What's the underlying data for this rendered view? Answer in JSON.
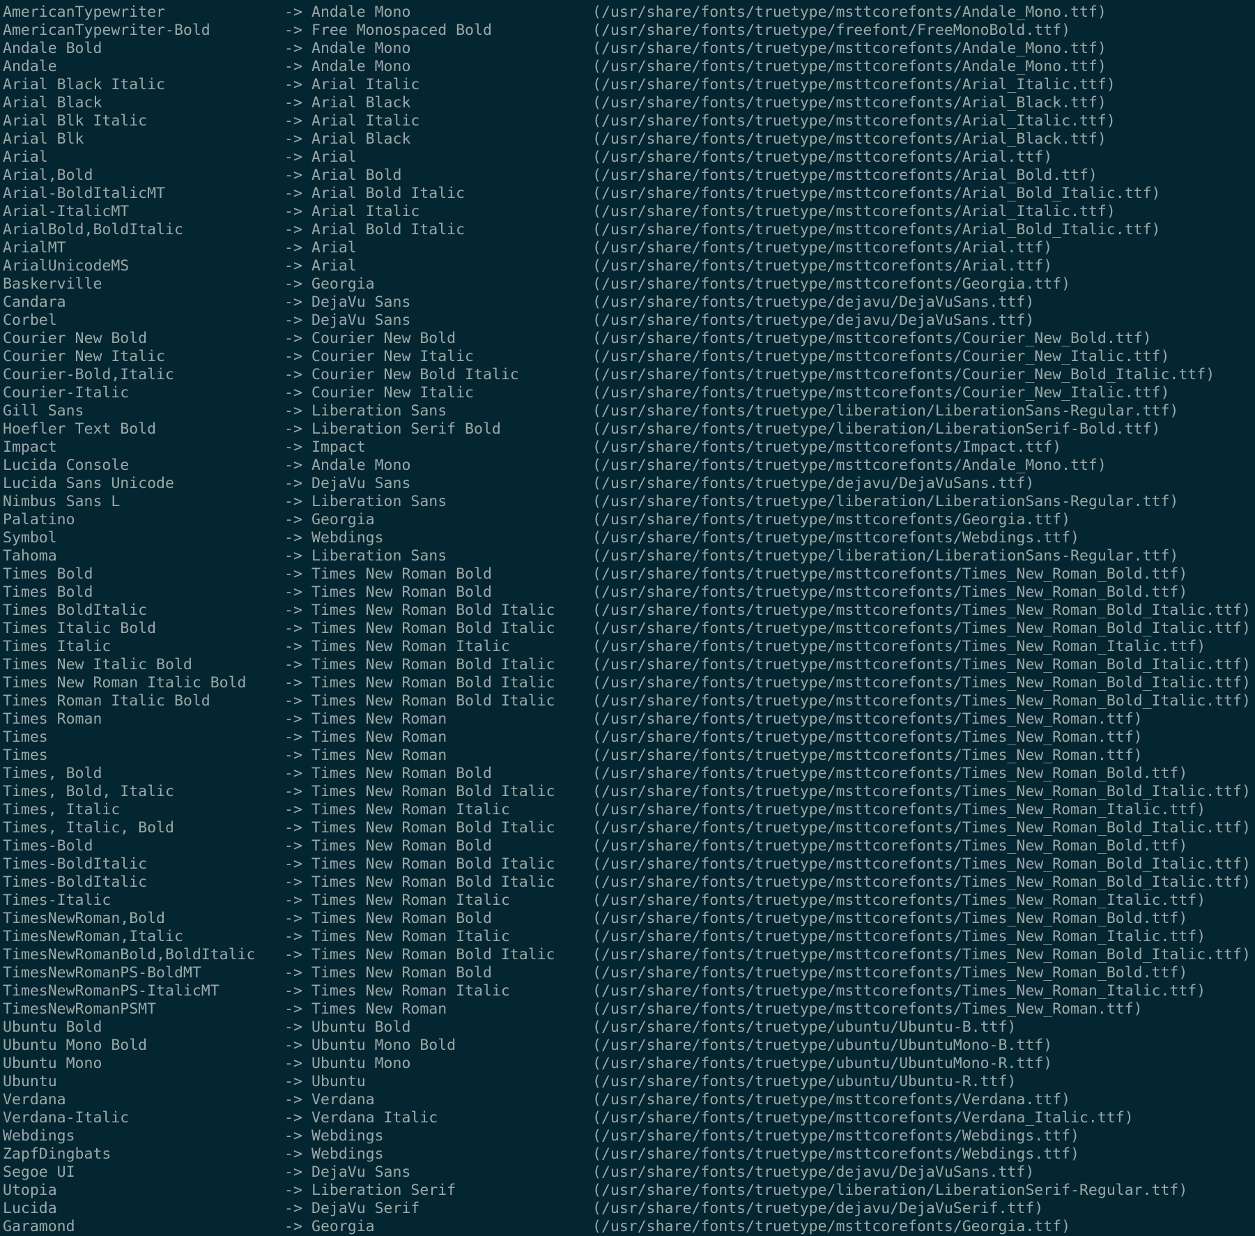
{
  "terminal": {
    "arrow": "->",
    "rows": [
      [
        "AmericanTypewriter",
        "Andale Mono",
        "(/usr/share/fonts/truetype/msttcorefonts/Andale_Mono.ttf)"
      ],
      [
        "AmericanTypewriter-Bold",
        "Free Monospaced Bold",
        "(/usr/share/fonts/truetype/freefont/FreeMonoBold.ttf)"
      ],
      [
        "Andale Bold",
        "Andale Mono",
        "(/usr/share/fonts/truetype/msttcorefonts/Andale_Mono.ttf)"
      ],
      [
        "Andale",
        "Andale Mono",
        "(/usr/share/fonts/truetype/msttcorefonts/Andale_Mono.ttf)"
      ],
      [
        "Arial Black Italic",
        "Arial Italic",
        "(/usr/share/fonts/truetype/msttcorefonts/Arial_Italic.ttf)"
      ],
      [
        "Arial Black",
        "Arial Black",
        "(/usr/share/fonts/truetype/msttcorefonts/Arial_Black.ttf)"
      ],
      [
        "Arial Blk Italic",
        "Arial Italic",
        "(/usr/share/fonts/truetype/msttcorefonts/Arial_Italic.ttf)"
      ],
      [
        "Arial Blk",
        "Arial Black",
        "(/usr/share/fonts/truetype/msttcorefonts/Arial_Black.ttf)"
      ],
      [
        "Arial",
        "Arial",
        "(/usr/share/fonts/truetype/msttcorefonts/Arial.ttf)"
      ],
      [
        "Arial,Bold",
        "Arial Bold",
        "(/usr/share/fonts/truetype/msttcorefonts/Arial_Bold.ttf)"
      ],
      [
        "Arial-BoldItalicMT",
        "Arial Bold Italic",
        "(/usr/share/fonts/truetype/msttcorefonts/Arial_Bold_Italic.ttf)"
      ],
      [
        "Arial-ItalicMT",
        "Arial Italic",
        "(/usr/share/fonts/truetype/msttcorefonts/Arial_Italic.ttf)"
      ],
      [
        "ArialBold,BoldItalic",
        "Arial Bold Italic",
        "(/usr/share/fonts/truetype/msttcorefonts/Arial_Bold_Italic.ttf)"
      ],
      [
        "ArialMT",
        "Arial",
        "(/usr/share/fonts/truetype/msttcorefonts/Arial.ttf)"
      ],
      [
        "ArialUnicodeMS",
        "Arial",
        "(/usr/share/fonts/truetype/msttcorefonts/Arial.ttf)"
      ],
      [
        "Baskerville",
        "Georgia",
        "(/usr/share/fonts/truetype/msttcorefonts/Georgia.ttf)"
      ],
      [
        "Candara",
        "DejaVu Sans",
        "(/usr/share/fonts/truetype/dejavu/DejaVuSans.ttf)"
      ],
      [
        "Corbel",
        "DejaVu Sans",
        "(/usr/share/fonts/truetype/dejavu/DejaVuSans.ttf)"
      ],
      [
        "Courier New Bold",
        "Courier New Bold",
        "(/usr/share/fonts/truetype/msttcorefonts/Courier_New_Bold.ttf)"
      ],
      [
        "Courier New Italic",
        "Courier New Italic",
        "(/usr/share/fonts/truetype/msttcorefonts/Courier_New_Italic.ttf)"
      ],
      [
        "Courier-Bold,Italic",
        "Courier New Bold Italic",
        "(/usr/share/fonts/truetype/msttcorefonts/Courier_New_Bold_Italic.ttf)"
      ],
      [
        "Courier-Italic",
        "Courier New Italic",
        "(/usr/share/fonts/truetype/msttcorefonts/Courier_New_Italic.ttf)"
      ],
      [
        "Gill Sans",
        "Liberation Sans",
        "(/usr/share/fonts/truetype/liberation/LiberationSans-Regular.ttf)"
      ],
      [
        "Hoefler Text Bold",
        "Liberation Serif Bold",
        "(/usr/share/fonts/truetype/liberation/LiberationSerif-Bold.ttf)"
      ],
      [
        "Impact",
        "Impact",
        "(/usr/share/fonts/truetype/msttcorefonts/Impact.ttf)"
      ],
      [
        "Lucida Console",
        "Andale Mono",
        "(/usr/share/fonts/truetype/msttcorefonts/Andale_Mono.ttf)"
      ],
      [
        "Lucida Sans Unicode",
        "DejaVu Sans",
        "(/usr/share/fonts/truetype/dejavu/DejaVuSans.ttf)"
      ],
      [
        "Nimbus Sans L",
        "Liberation Sans",
        "(/usr/share/fonts/truetype/liberation/LiberationSans-Regular.ttf)"
      ],
      [
        "Palatino",
        "Georgia",
        "(/usr/share/fonts/truetype/msttcorefonts/Georgia.ttf)"
      ],
      [
        "Symbol",
        "Webdings",
        "(/usr/share/fonts/truetype/msttcorefonts/Webdings.ttf)"
      ],
      [
        "Tahoma",
        "Liberation Sans",
        "(/usr/share/fonts/truetype/liberation/LiberationSans-Regular.ttf)"
      ],
      [
        "Times Bold",
        "Times New Roman Bold",
        "(/usr/share/fonts/truetype/msttcorefonts/Times_New_Roman_Bold.ttf)"
      ],
      [
        "Times Bold",
        "Times New Roman Bold",
        "(/usr/share/fonts/truetype/msttcorefonts/Times_New_Roman_Bold.ttf)"
      ],
      [
        "Times BoldItalic",
        "Times New Roman Bold Italic",
        "(/usr/share/fonts/truetype/msttcorefonts/Times_New_Roman_Bold_Italic.ttf)"
      ],
      [
        "Times Italic Bold",
        "Times New Roman Bold Italic",
        "(/usr/share/fonts/truetype/msttcorefonts/Times_New_Roman_Bold_Italic.ttf)"
      ],
      [
        "Times Italic",
        "Times New Roman Italic",
        "(/usr/share/fonts/truetype/msttcorefonts/Times_New_Roman_Italic.ttf)"
      ],
      [
        "Times New Italic Bold",
        "Times New Roman Bold Italic",
        "(/usr/share/fonts/truetype/msttcorefonts/Times_New_Roman_Bold_Italic.ttf)"
      ],
      [
        "Times New Roman Italic Bold",
        "Times New Roman Bold Italic",
        "(/usr/share/fonts/truetype/msttcorefonts/Times_New_Roman_Bold_Italic.ttf)"
      ],
      [
        "Times Roman Italic Bold",
        "Times New Roman Bold Italic",
        "(/usr/share/fonts/truetype/msttcorefonts/Times_New_Roman_Bold_Italic.ttf)"
      ],
      [
        "Times Roman",
        "Times New Roman",
        "(/usr/share/fonts/truetype/msttcorefonts/Times_New_Roman.ttf)"
      ],
      [
        "Times",
        "Times New Roman",
        "(/usr/share/fonts/truetype/msttcorefonts/Times_New_Roman.ttf)"
      ],
      [
        "Times",
        "Times New Roman",
        "(/usr/share/fonts/truetype/msttcorefonts/Times_New_Roman.ttf)"
      ],
      [
        "Times, Bold",
        "Times New Roman Bold",
        "(/usr/share/fonts/truetype/msttcorefonts/Times_New_Roman_Bold.ttf)"
      ],
      [
        "Times, Bold, Italic",
        "Times New Roman Bold Italic",
        "(/usr/share/fonts/truetype/msttcorefonts/Times_New_Roman_Bold_Italic.ttf)"
      ],
      [
        "Times, Italic",
        "Times New Roman Italic",
        "(/usr/share/fonts/truetype/msttcorefonts/Times_New_Roman_Italic.ttf)"
      ],
      [
        "Times, Italic, Bold",
        "Times New Roman Bold Italic",
        "(/usr/share/fonts/truetype/msttcorefonts/Times_New_Roman_Bold_Italic.ttf)"
      ],
      [
        "Times-Bold",
        "Times New Roman Bold",
        "(/usr/share/fonts/truetype/msttcorefonts/Times_New_Roman_Bold.ttf)"
      ],
      [
        "Times-BoldItalic",
        "Times New Roman Bold Italic",
        "(/usr/share/fonts/truetype/msttcorefonts/Times_New_Roman_Bold_Italic.ttf)"
      ],
      [
        "Times-BoldItalic",
        "Times New Roman Bold Italic",
        "(/usr/share/fonts/truetype/msttcorefonts/Times_New_Roman_Bold_Italic.ttf)"
      ],
      [
        "Times-Italic",
        "Times New Roman Italic",
        "(/usr/share/fonts/truetype/msttcorefonts/Times_New_Roman_Italic.ttf)"
      ],
      [
        "TimesNewRoman,Bold",
        "Times New Roman Bold",
        "(/usr/share/fonts/truetype/msttcorefonts/Times_New_Roman_Bold.ttf)"
      ],
      [
        "TimesNewRoman,Italic",
        "Times New Roman Italic",
        "(/usr/share/fonts/truetype/msttcorefonts/Times_New_Roman_Italic.ttf)"
      ],
      [
        "TimesNewRomanBold,BoldItalic",
        "Times New Roman Bold Italic",
        "(/usr/share/fonts/truetype/msttcorefonts/Times_New_Roman_Bold_Italic.ttf)"
      ],
      [
        "TimesNewRomanPS-BoldMT",
        "Times New Roman Bold",
        "(/usr/share/fonts/truetype/msttcorefonts/Times_New_Roman_Bold.ttf)"
      ],
      [
        "TimesNewRomanPS-ItalicMT",
        "Times New Roman Italic",
        "(/usr/share/fonts/truetype/msttcorefonts/Times_New_Roman_Italic.ttf)"
      ],
      [
        "TimesNewRomanPSMT",
        "Times New Roman",
        "(/usr/share/fonts/truetype/msttcorefonts/Times_New_Roman.ttf)"
      ],
      [
        "Ubuntu Bold",
        "Ubuntu Bold",
        "(/usr/share/fonts/truetype/ubuntu/Ubuntu-B.ttf)"
      ],
      [
        "Ubuntu Mono Bold",
        "Ubuntu Mono Bold",
        "(/usr/share/fonts/truetype/ubuntu/UbuntuMono-B.ttf)"
      ],
      [
        "Ubuntu Mono",
        "Ubuntu Mono",
        "(/usr/share/fonts/truetype/ubuntu/UbuntuMono-R.ttf)"
      ],
      [
        "Ubuntu",
        "Ubuntu",
        "(/usr/share/fonts/truetype/ubuntu/Ubuntu-R.ttf)"
      ],
      [
        "Verdana",
        "Verdana",
        "(/usr/share/fonts/truetype/msttcorefonts/Verdana.ttf)"
      ],
      [
        "Verdana-Italic",
        "Verdana Italic",
        "(/usr/share/fonts/truetype/msttcorefonts/Verdana_Italic.ttf)"
      ],
      [
        "Webdings",
        "Webdings",
        "(/usr/share/fonts/truetype/msttcorefonts/Webdings.ttf)"
      ],
      [
        "ZapfDingbats",
        "Webdings",
        "(/usr/share/fonts/truetype/msttcorefonts/Webdings.ttf)"
      ],
      [
        "Segoe UI",
        "DejaVu Sans",
        "(/usr/share/fonts/truetype/dejavu/DejaVuSans.ttf)"
      ],
      [
        "Utopia",
        "Liberation Serif",
        "(/usr/share/fonts/truetype/liberation/LiberationSerif-Regular.ttf)"
      ],
      [
        "Lucida",
        "DejaVu Serif",
        "(/usr/share/fonts/truetype/dejavu/DejaVuSerif.ttf)"
      ],
      [
        "Garamond",
        "Georgia",
        "(/usr/share/fonts/truetype/msttcorefonts/Georgia.ttf)"
      ]
    ]
  },
  "colors": {
    "background": "#042631",
    "text": "#9aa8a8"
  }
}
